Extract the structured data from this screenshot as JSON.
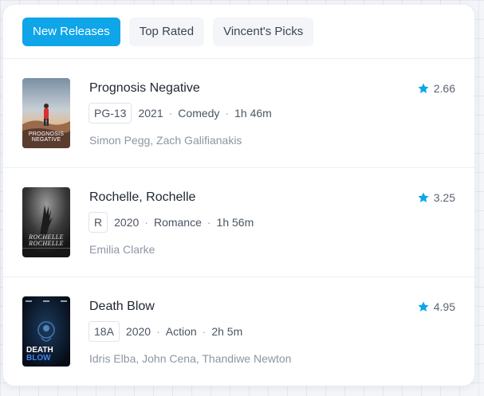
{
  "tabs": [
    {
      "label": "New Releases",
      "active": true
    },
    {
      "label": "Top Rated",
      "active": false
    },
    {
      "label": "Vincent's Picks",
      "active": false
    }
  ],
  "movies": [
    {
      "title": "Prognosis Negative",
      "rating": "2.66",
      "certification": "PG-13",
      "year": "2021",
      "genre": "Comedy",
      "runtime": "1h 46m",
      "cast": "Simon Pegg, Zach Galifianakis",
      "poster": {
        "lines": [
          "PROGNOSIS",
          "NEGATIVE"
        ]
      }
    },
    {
      "title": "Rochelle, Rochelle",
      "rating": "3.25",
      "certification": "R",
      "year": "2020",
      "genre": "Romance",
      "runtime": "1h 56m",
      "cast": "Emilia Clarke",
      "poster": {
        "lines": [
          "ROCHELLE",
          "ROCHELLE"
        ]
      }
    },
    {
      "title": "Death Blow",
      "rating": "4.95",
      "certification": "18A",
      "year": "2020",
      "genre": "Action",
      "runtime": "2h 5m",
      "cast": "Idris Elba, John Cena, Thandiwe Newton",
      "poster": {
        "lines": [
          "DEATH",
          "BLOW"
        ]
      }
    }
  ],
  "colors": {
    "accent": "#0ea5e9",
    "star": "#0ea5e9",
    "title_text": "#1e2530",
    "muted_text": "#8c96a3"
  },
  "icons": {
    "rating": "star-icon"
  }
}
